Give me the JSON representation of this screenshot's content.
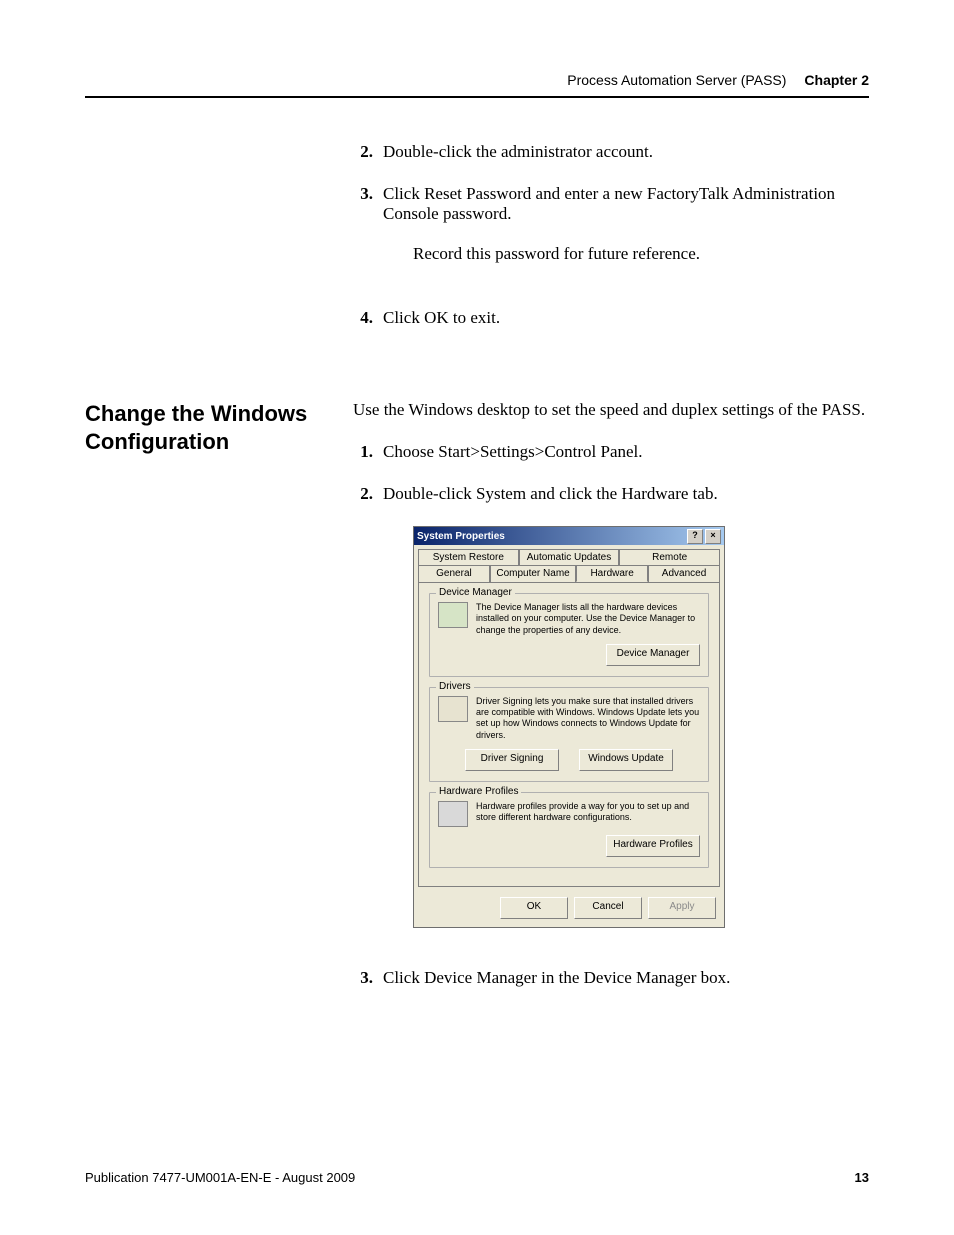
{
  "header": {
    "doc_section": "Process Automation Server (PASS)",
    "chapter": "Chapter 2"
  },
  "section1": {
    "steps": [
      {
        "n": "2.",
        "text": "Double-click the administrator account."
      },
      {
        "n": "3.",
        "text": "Click Reset Password and enter a new FactoryTalk Administration Console password.",
        "after": "Record this password for future reference."
      },
      {
        "n": "4.",
        "text": "Click OK to exit."
      }
    ]
  },
  "section2": {
    "heading": "Change the Windows Configuration",
    "intro": "Use the Windows desktop to set the speed and duplex settings of the PASS.",
    "steps_before": [
      {
        "n": "1.",
        "text": "Choose Start>Settings>Control Panel."
      },
      {
        "n": "2.",
        "text": "Double-click System and click the Hardware tab."
      }
    ],
    "steps_after": [
      {
        "n": "3.",
        "text": "Click Device Manager in the Device Manager box."
      }
    ]
  },
  "dialog": {
    "title": "System Properties",
    "tabs_row1": [
      "System Restore",
      "Automatic Updates",
      "Remote"
    ],
    "tabs_row2": [
      "General",
      "Computer Name",
      "Hardware",
      "Advanced"
    ],
    "selected_tab": "Hardware",
    "device_manager": {
      "legend": "Device Manager",
      "text": "The Device Manager lists all the hardware devices installed on your computer. Use the Device Manager to change the properties of any device.",
      "button": "Device Manager"
    },
    "drivers": {
      "legend": "Drivers",
      "text": "Driver Signing lets you make sure that installed drivers are compatible with Windows. Windows Update lets you set up how Windows connects to Windows Update for drivers.",
      "button1": "Driver Signing",
      "button2": "Windows Update"
    },
    "hardware_profiles": {
      "legend": "Hardware Profiles",
      "text": "Hardware profiles provide a way for you to set up and store different hardware configurations.",
      "button": "Hardware Profiles"
    },
    "ok": "OK",
    "cancel": "Cancel",
    "apply": "Apply",
    "help_glyph": "?",
    "close_glyph": "×"
  },
  "footer": {
    "pub": "Publication 7477-UM001A-EN-E - August 2009",
    "page": "13"
  }
}
